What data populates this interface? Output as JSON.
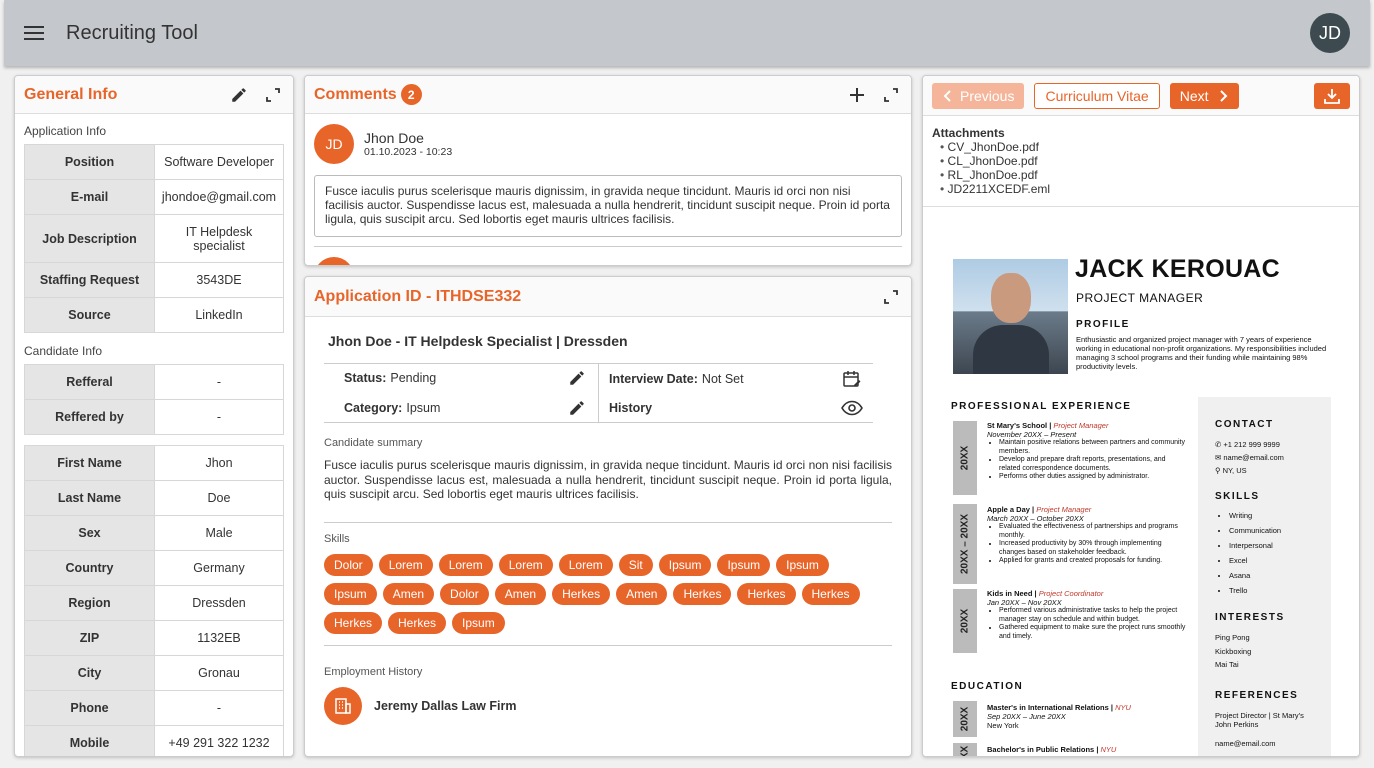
{
  "app": {
    "title": "Recruiting Tool",
    "user_initials": "JD"
  },
  "general": {
    "title": "General Info",
    "app_info_label": "Application Info",
    "app_info": [
      {
        "k": "Position",
        "v": "Software Developer"
      },
      {
        "k": "E-mail",
        "v": "jhondoe@gmail.com"
      },
      {
        "k": "Job Description",
        "v": "IT Helpdesk specialist"
      },
      {
        "k": "Staffing Request",
        "v": "3543DE"
      },
      {
        "k": "Source",
        "v": "LinkedIn"
      }
    ],
    "cand_info_label": "Candidate Info",
    "referral": [
      {
        "k": "Refferal",
        "v": "-"
      },
      {
        "k": "Reffered by",
        "v": "-"
      }
    ],
    "personal": [
      {
        "k": "First Name",
        "v": "Jhon"
      },
      {
        "k": "Last Name",
        "v": "Doe"
      },
      {
        "k": "Sex",
        "v": "Male"
      },
      {
        "k": "Country",
        "v": "Germany"
      },
      {
        "k": "Region",
        "v": "Dressden"
      },
      {
        "k": "ZIP",
        "v": "1132EB"
      },
      {
        "k": "City",
        "v": "Gronau"
      },
      {
        "k": "Phone",
        "v": "-"
      },
      {
        "k": "Mobile",
        "v": "+49 291 322 1232"
      }
    ]
  },
  "comments": {
    "title": "Comments",
    "count": "2",
    "items": [
      {
        "initials": "JD",
        "name": "Jhon Doe",
        "date": "01.10.2023 - 10:23",
        "text": "Fusce iaculis purus scelerisque mauris dignissim, in gravida neque tincidunt. Mauris id orci non nisi facilisis auctor. Suspendisse lacus est, malesuada a nulla hendrerit, tincidunt suscipit neque. Proin id porta ligula, quis suscipit arcu. Sed lobortis eget mauris ultrices facilisis."
      }
    ]
  },
  "application": {
    "title": "Application ID - ITHDSE332",
    "subtitle": "Jhon Doe - IT Helpdesk Specialist | Dressden",
    "status_label": "Status:",
    "status_value": "Pending",
    "category_label": "Category:",
    "category_value": "Ipsum",
    "interview_label": "Interview Date:",
    "interview_value": "Not Set",
    "history_label": "History",
    "summary_label": "Candidate summary",
    "summary": "Fusce iaculis purus scelerisque mauris dignissim, in gravida neque tincidunt. Mauris id orci non nisi facilisis auctor. Suspendisse lacus est, malesuada a nulla hendrerit, tincidunt suscipit neque. Proin id porta ligula, quis suscipit arcu. Sed lobortis eget mauris ultrices facilisis.",
    "skills_label": "Skills",
    "skills": [
      "Dolor",
      "Lorem",
      "Lorem",
      "Lorem",
      "Lorem",
      "Sit",
      "Ipsum",
      "Ipsum",
      "Ipsum",
      "Ipsum",
      "Amen",
      "Dolor",
      "Amen",
      "Herkes",
      "Amen",
      "Herkes",
      "Herkes",
      "Herkes",
      "Herkes",
      "Herkes",
      "Ipsum"
    ],
    "employment_label": "Employment History",
    "employer": "Jeremy Dallas Law Firm"
  },
  "viewer": {
    "prev": "Previous",
    "cv": "Curriculum Vitae",
    "next": "Next",
    "attachments_label": "Attachments",
    "attachments": [
      "CV_JhonDoe.pdf",
      "CL_JhonDoe.pdf",
      "RL_JhonDoe.pdf",
      "JD2211XCEDF.eml"
    ]
  },
  "cv": {
    "name": "JACK KEROUAC",
    "role": "PROJECT MANAGER",
    "profile_label": "PROFILE",
    "profile": "Enthusiastic and organized project manager with 7 years of experience working in educational non-profit organizations. My responsibilities included managing 3 school programs and their funding while maintaining 98% productivity levels.",
    "exp_label": "PROFESSIONAL EXPERIENCE",
    "jobs": [
      {
        "bar": "20XX",
        "org": "St Mary's School",
        "title": "Project Manager",
        "dates": "November 20XX – Present",
        "bullets": [
          "Maintain positive relations between partners and community members.",
          "Develop and prepare draft reports, presentations, and related correspondence documents.",
          "Performs other duties assigned by administrator."
        ]
      },
      {
        "bar": "20XX – 20XX",
        "org": "Apple a Day",
        "title": "Project Manager",
        "dates": "March 20XX – October 20XX",
        "bullets": [
          "Evaluated the effectiveness of partnerships and programs monthly.",
          "Increased productivity by 30% through implementing changes based on stakeholder feedback.",
          "Applied for grants and created proposals for funding."
        ]
      },
      {
        "bar": "20XX",
        "org": "Kids in Need",
        "title": "Project Coordinator",
        "dates": "Jan 20XX – Nov 20XX",
        "bullets": [
          "Performed various administrative tasks to help the project manager stay on schedule and within budget.",
          "Gathered equipment to make sure the project runs smoothly and timely."
        ]
      }
    ],
    "edu_label": "EDUCATION",
    "edu": [
      {
        "bar": "20XX",
        "degree": "Master's in International Relations",
        "school": "NYU",
        "dates": "Sep 20XX – June 20XX",
        "place": "New York"
      },
      {
        "bar": "20XX",
        "degree": "Bachelor's in Public Relations",
        "school": "NYU"
      }
    ],
    "contact_label": "CONTACT",
    "phone": "+1 212 999 9999",
    "email": "name@email.com",
    "location": "NY, US",
    "skills_label": "SKILLS",
    "skills": [
      "Writing",
      "Communication",
      "Interpersonal",
      "Excel",
      "Asana",
      "Trello"
    ],
    "interests_label": "INTERESTS",
    "interests": [
      "Ping Pong",
      "Kickboxing",
      "Mai Tai"
    ],
    "refs_label": "REFERENCES",
    "ref_line1": "Project Director | St Mary's",
    "ref_line2": "John Perkins",
    "ref_email": "name@email.com"
  },
  "colors": {
    "accent": "#e8652a",
    "topbar": "#c4c8cc"
  }
}
